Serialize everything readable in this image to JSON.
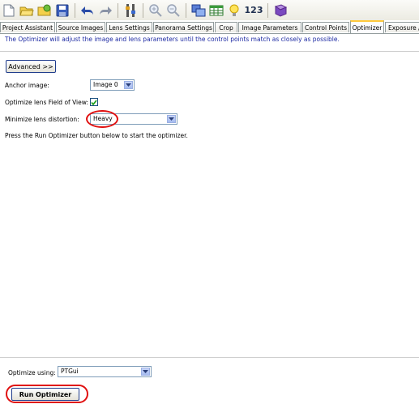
{
  "toolbar": {
    "icons": [
      "new-document-icon",
      "open-folder-icon",
      "open-recent-icon",
      "save-icon",
      "undo-icon",
      "redo-icon",
      "preferences-icon",
      "zoom-in-icon",
      "zoom-out-icon",
      "panorama-editor-icon",
      "table-icon",
      "lightbulb-icon",
      "numbers-icon",
      "help-book-icon"
    ],
    "numbers_label": "123"
  },
  "tabs": [
    {
      "label": "Project Assistant",
      "active": false
    },
    {
      "label": "Source Images",
      "active": false
    },
    {
      "label": "Lens Settings",
      "active": false
    },
    {
      "label": "Panorama Settings",
      "active": false
    },
    {
      "label": "Crop",
      "active": false
    },
    {
      "label": "Image Parameters",
      "active": false
    },
    {
      "label": "Control Points",
      "active": false
    },
    {
      "label": "Optimizer",
      "active": true
    },
    {
      "label": "Exposure /",
      "active": false
    }
  ],
  "info_text": "The Optimizer will adjust the image and lens parameters until the control points match as closely as possible.",
  "advanced_button": "Advanced >>",
  "form": {
    "anchor_label": "Anchor image:",
    "anchor_value": "Image 0",
    "fov_label": "Optimize lens Field of View:",
    "fov_checked": true,
    "distortion_label": "Minimize lens distortion:",
    "distortion_value": "Heavy",
    "hint": "Press the Run Optimizer button below to start the optimizer."
  },
  "bottom": {
    "optimize_using_label": "Optimize using:",
    "optimize_using_value": "PTGui",
    "run_button": "Run Optimizer"
  },
  "colors": {
    "info_text": "#1d2aa3",
    "highlight": "#e01010",
    "active_tab_accent": "#ffc83c"
  }
}
